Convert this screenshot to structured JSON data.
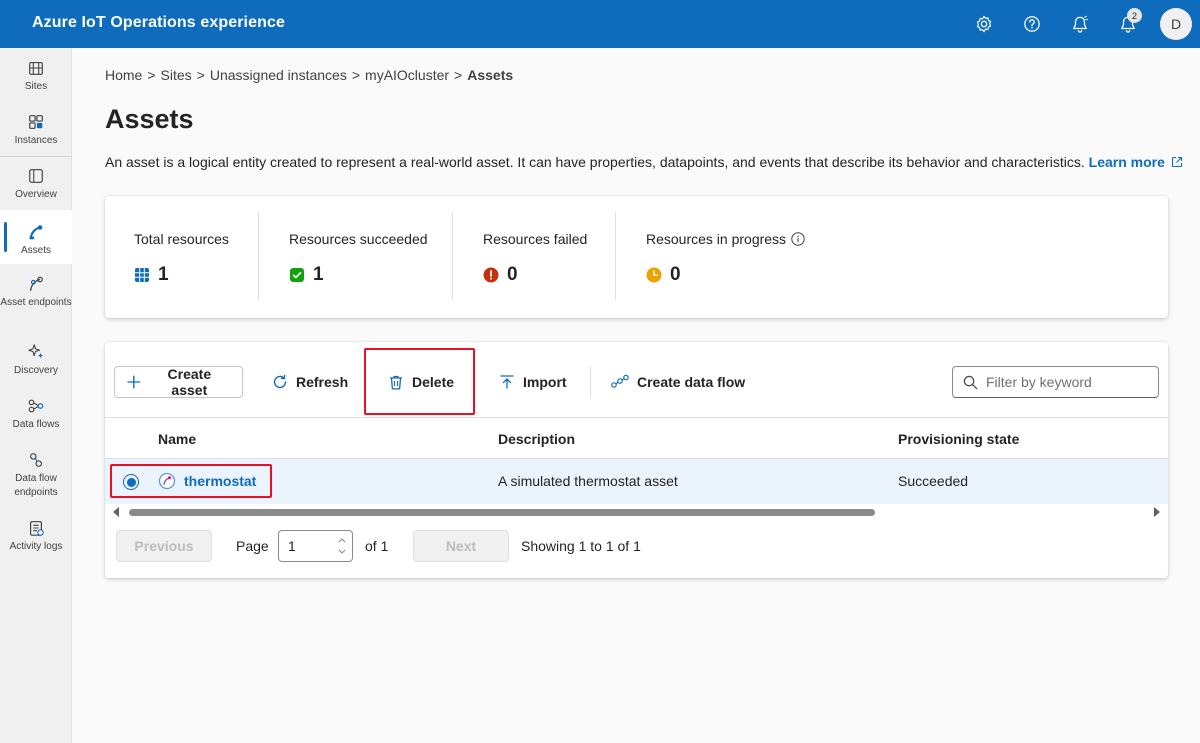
{
  "header": {
    "title": "Azure IoT Operations experience",
    "notification_count": "2",
    "avatar_initial": "D",
    "icons": [
      "settings-gear-icon",
      "help-icon",
      "feedback-icon",
      "notification-bell-icon"
    ]
  },
  "sidebar": {
    "items": [
      {
        "label": "Sites",
        "icon": "sites-icon"
      },
      {
        "label": "Instances",
        "icon": "instances-icon"
      },
      {
        "label": "Overview",
        "icon": "overview-icon"
      },
      {
        "label": "Assets",
        "icon": "assets-icon",
        "active": true
      },
      {
        "label": "Asset endpoints",
        "icon": "asset-endpoints-icon"
      },
      {
        "label": "Discovery",
        "icon": "discovery-icon"
      },
      {
        "label": "Data flows",
        "icon": "data-flows-icon"
      },
      {
        "label": "Data flow endpoints",
        "icon": "data-flow-endpoints-icon"
      },
      {
        "label": "Activity logs",
        "icon": "activity-logs-icon"
      }
    ]
  },
  "breadcrumb": {
    "items": [
      "Home",
      "Sites",
      "Unassigned instances",
      "myAIOcluster"
    ],
    "current": "Assets",
    "separator": ">"
  },
  "page": {
    "title": "Assets",
    "description": "An asset is a logical entity created to represent a real-world asset. It can have properties, datapoints, and events that describe its behavior and characteristics.",
    "learn_more": "Learn more"
  },
  "summary": {
    "total": {
      "label": "Total resources",
      "value": "1"
    },
    "succeeded": {
      "label": "Resources succeeded",
      "value": "1"
    },
    "failed": {
      "label": "Resources failed",
      "value": "0"
    },
    "in_progress": {
      "label": "Resources in progress",
      "value": "0"
    }
  },
  "toolbar": {
    "create": "Create asset",
    "refresh": "Refresh",
    "delete": "Delete",
    "import": "Import",
    "create_flow": "Create data flow",
    "filter_placeholder": "Filter by keyword"
  },
  "table": {
    "columns": [
      "Name",
      "Description",
      "Provisioning state"
    ],
    "rows": [
      {
        "name": "thermostat",
        "description": "A simulated thermostat asset",
        "state": "Succeeded",
        "selected": true
      }
    ]
  },
  "pagination": {
    "previous": "Previous",
    "page_label": "Page",
    "page_value": "1",
    "of_label": "of 1",
    "next": "Next",
    "showing": "Showing 1 to 1 of 1"
  },
  "colors": {
    "brand": "#0f6cbd",
    "success": "#13a10e",
    "error": "#c4310c",
    "warning": "#eaa300",
    "highlight": "#e81123"
  }
}
